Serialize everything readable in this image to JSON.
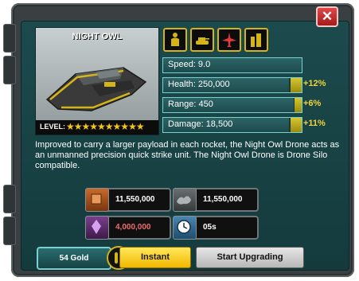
{
  "unit": {
    "name": "NIGHT OWL",
    "level_label": "LEVEL:",
    "level_stars": 10,
    "stars_text": "★★★★★★★★★★"
  },
  "role_icons": [
    "infantry-icon",
    "tank-icon",
    "aircraft-icon",
    "building-icon"
  ],
  "stats": [
    {
      "label": "Speed: 9.0",
      "fill": 1.0,
      "bonus": ""
    },
    {
      "label": "Health: 250,000",
      "fill": 0.91,
      "bonus": "+12%"
    },
    {
      "label": "Range: 450",
      "fill": 0.94,
      "bonus": "+6%"
    },
    {
      "label": "Damage: 18,500",
      "fill": 0.91,
      "bonus": "+11%"
    }
  ],
  "description": "Improved to carry a larger payload in each rocket, the Night Owl Drone acts as an unmanned precision quick strike unit. The Night Owl Drone is Drone Silo compatible.",
  "costs": {
    "metal": "11,550,000",
    "oil": "11,550,000",
    "crystal": "4,000,000",
    "time": "05s"
  },
  "buttons": {
    "gold": "54 Gold",
    "instant": "Instant",
    "upgrade": "Start Upgrading"
  },
  "colors": {
    "panel": "#1c4b4d",
    "accent_yellow": "#f0d43a",
    "stat_border": "#7ad0cf",
    "close_red": "#d03232"
  }
}
